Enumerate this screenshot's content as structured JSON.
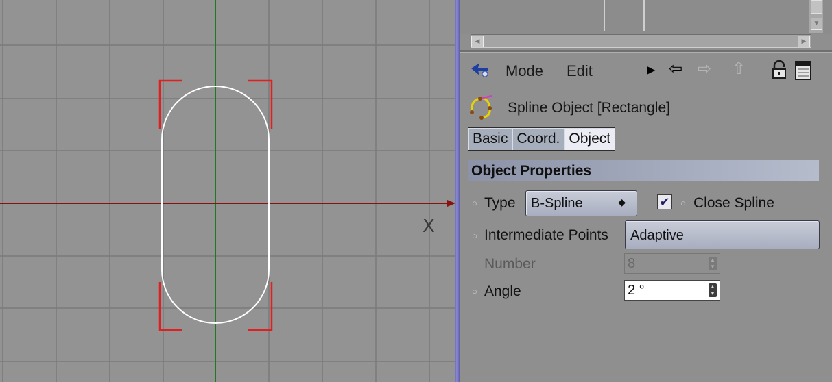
{
  "viewport": {
    "axis_label": "X"
  },
  "attribute_manager": {
    "menu": {
      "mode_label": "Mode",
      "edit_label": "Edit"
    },
    "object_title": "Spline Object [Rectangle]",
    "tabs": [
      {
        "label": "Basic",
        "active": false
      },
      {
        "label": "Coord.",
        "active": false
      },
      {
        "label": "Object",
        "active": true
      }
    ],
    "section_title": "Object Properties",
    "properties": {
      "type_label": "Type",
      "type_value": "B-Spline",
      "close_spline_label": "Close Spline",
      "close_spline_checked": true,
      "intermediate_points_label": "Intermediate Points",
      "intermediate_points_value": "Adaptive",
      "number_label": "Number",
      "number_value": "8",
      "angle_label": "Angle",
      "angle_value": "2 °"
    }
  },
  "icons": {
    "pointer": "pointer-icon",
    "play": "play-icon",
    "back": "back-arrow-icon",
    "forward": "forward-arrow-icon",
    "up": "up-arrow-icon",
    "lock": "lock-icon",
    "new_window": "new-window-icon",
    "spline": "spline-object-icon",
    "checkbox_check": "checkmark-icon"
  },
  "colors": {
    "grid_line": "#7a7a7a",
    "x_axis": "#8b1010",
    "y_axis": "#1e7a1e",
    "spline": "#ffffff",
    "selection_bracket": "#e02020",
    "divider": "#7a7ac4"
  }
}
